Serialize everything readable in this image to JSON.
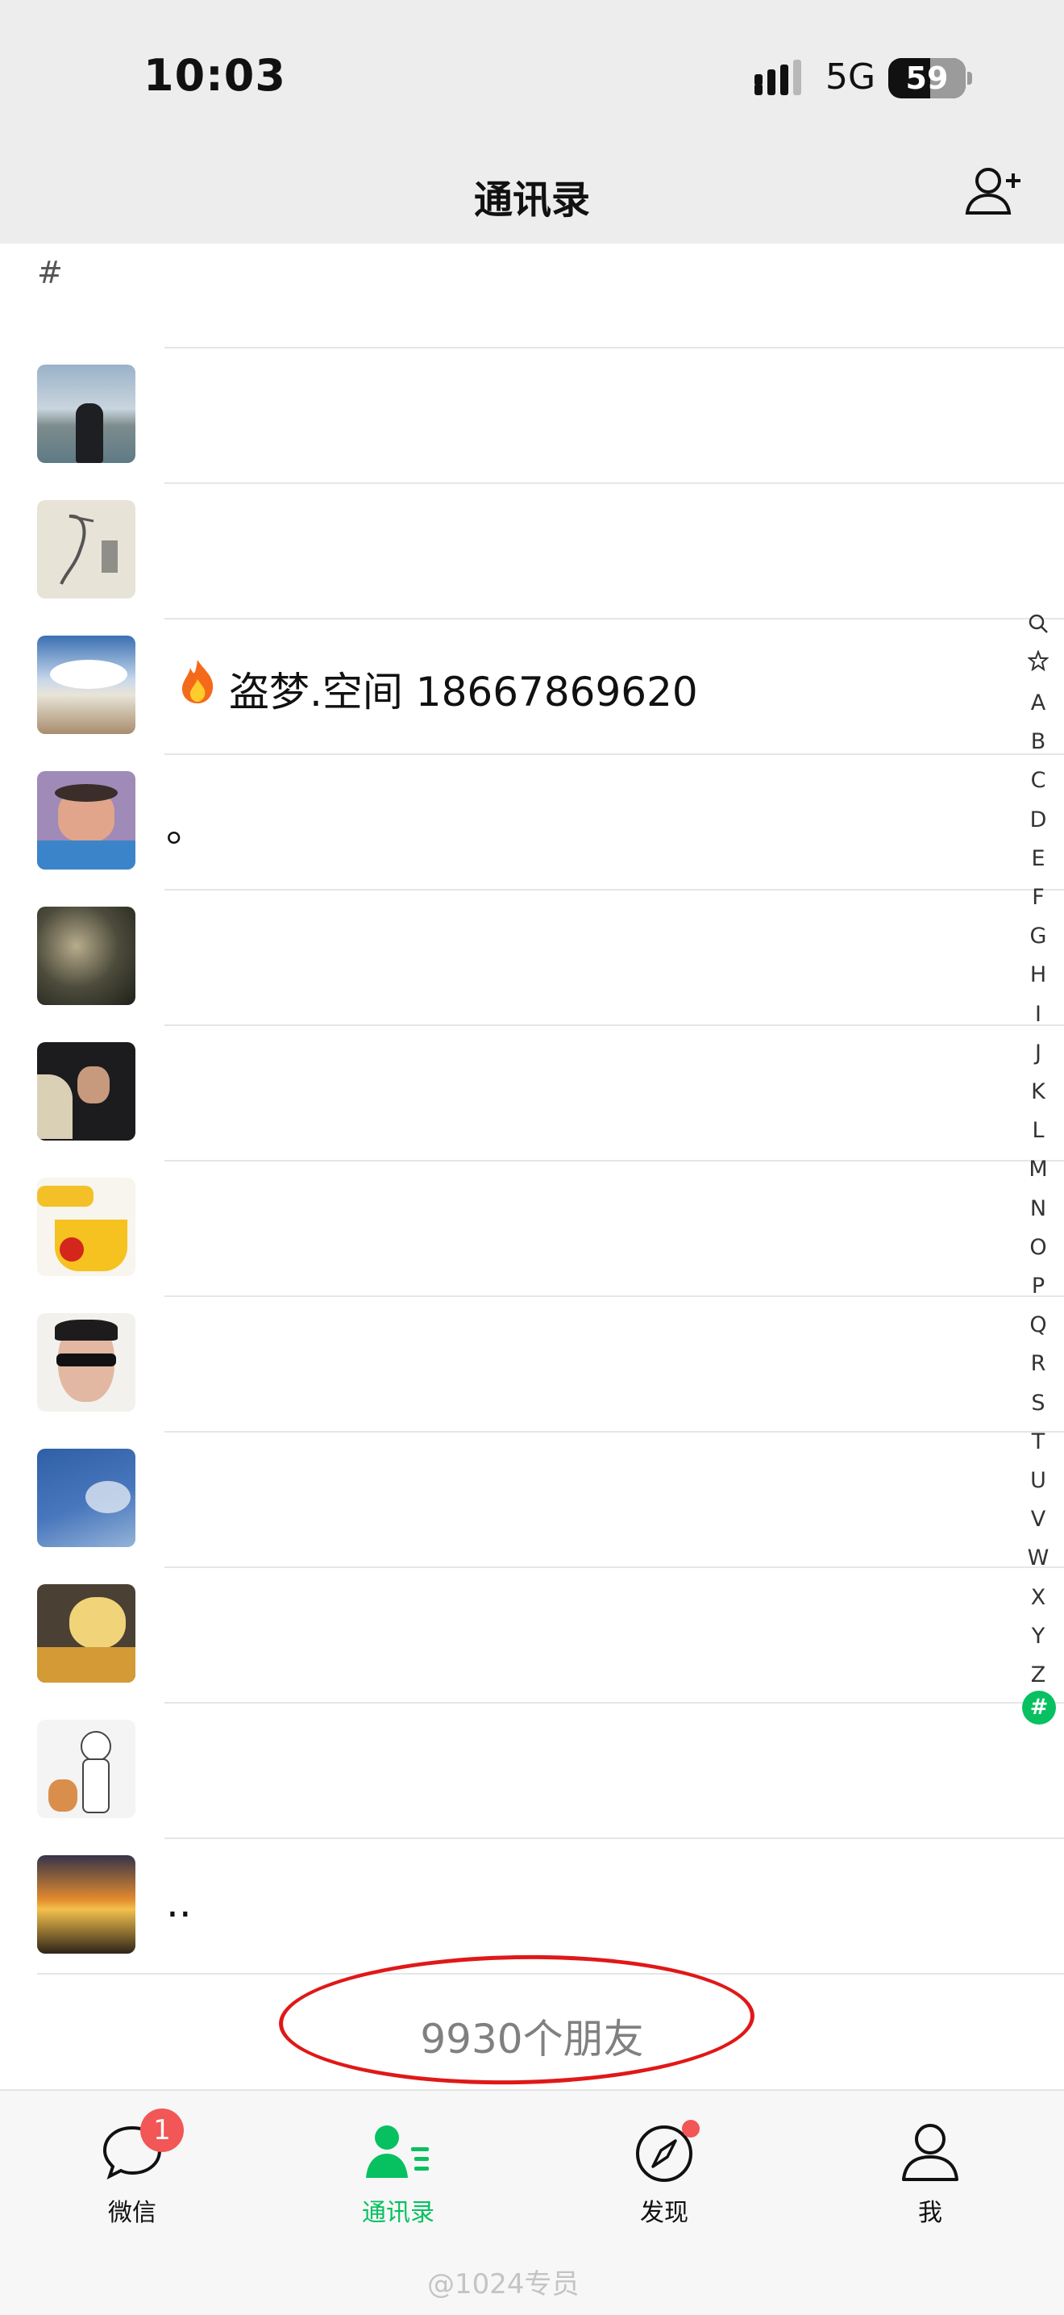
{
  "status_bar": {
    "time": "10:03",
    "network": "5G",
    "battery": "59"
  },
  "header": {
    "title": "通讯录",
    "add_icon": "add-contact-icon"
  },
  "section": {
    "letter": "#"
  },
  "contacts": [
    {
      "name": "",
      "avatar": "man-by-lake"
    },
    {
      "name": "",
      "avatar": "heron-painting"
    },
    {
      "name": "盗梦.空间 18667869620",
      "avatar": "sky-cloud-road",
      "emoji": "fire"
    },
    {
      "name": "。",
      "avatar": "cartoon-man-purple"
    },
    {
      "name": "",
      "avatar": "dark-abstract"
    },
    {
      "name": "",
      "avatar": "person-with-pet"
    },
    {
      "name": "",
      "avatar": "cartoon-dog-cup"
    },
    {
      "name": "",
      "avatar": "man-sunglasses"
    },
    {
      "name": "",
      "avatar": "blue-sky-clouds"
    },
    {
      "name": "",
      "avatar": "plush-pudding-dog"
    },
    {
      "name": "",
      "avatar": "sketch-boy-bear"
    },
    {
      "name": "..",
      "avatar": "sunset-landscape"
    }
  ],
  "index_bar": [
    "search",
    "star",
    "A",
    "B",
    "C",
    "D",
    "E",
    "F",
    "G",
    "H",
    "I",
    "J",
    "K",
    "L",
    "M",
    "N",
    "O",
    "P",
    "Q",
    "R",
    "S",
    "T",
    "U",
    "V",
    "W",
    "X",
    "Y",
    "Z",
    "#"
  ],
  "friend_count": "9930个朋友",
  "tabs": [
    {
      "label": "微信",
      "icon": "chat-bubble-icon",
      "badge": "1"
    },
    {
      "label": "通讯录",
      "icon": "contacts-icon",
      "active": true
    },
    {
      "label": "发现",
      "icon": "compass-icon",
      "dot": true
    },
    {
      "label": "我",
      "icon": "person-icon"
    }
  ],
  "watermark": "@1024专员",
  "colors": {
    "accent": "#07c160",
    "badge": "#f25656",
    "annotation": "#e01818"
  }
}
